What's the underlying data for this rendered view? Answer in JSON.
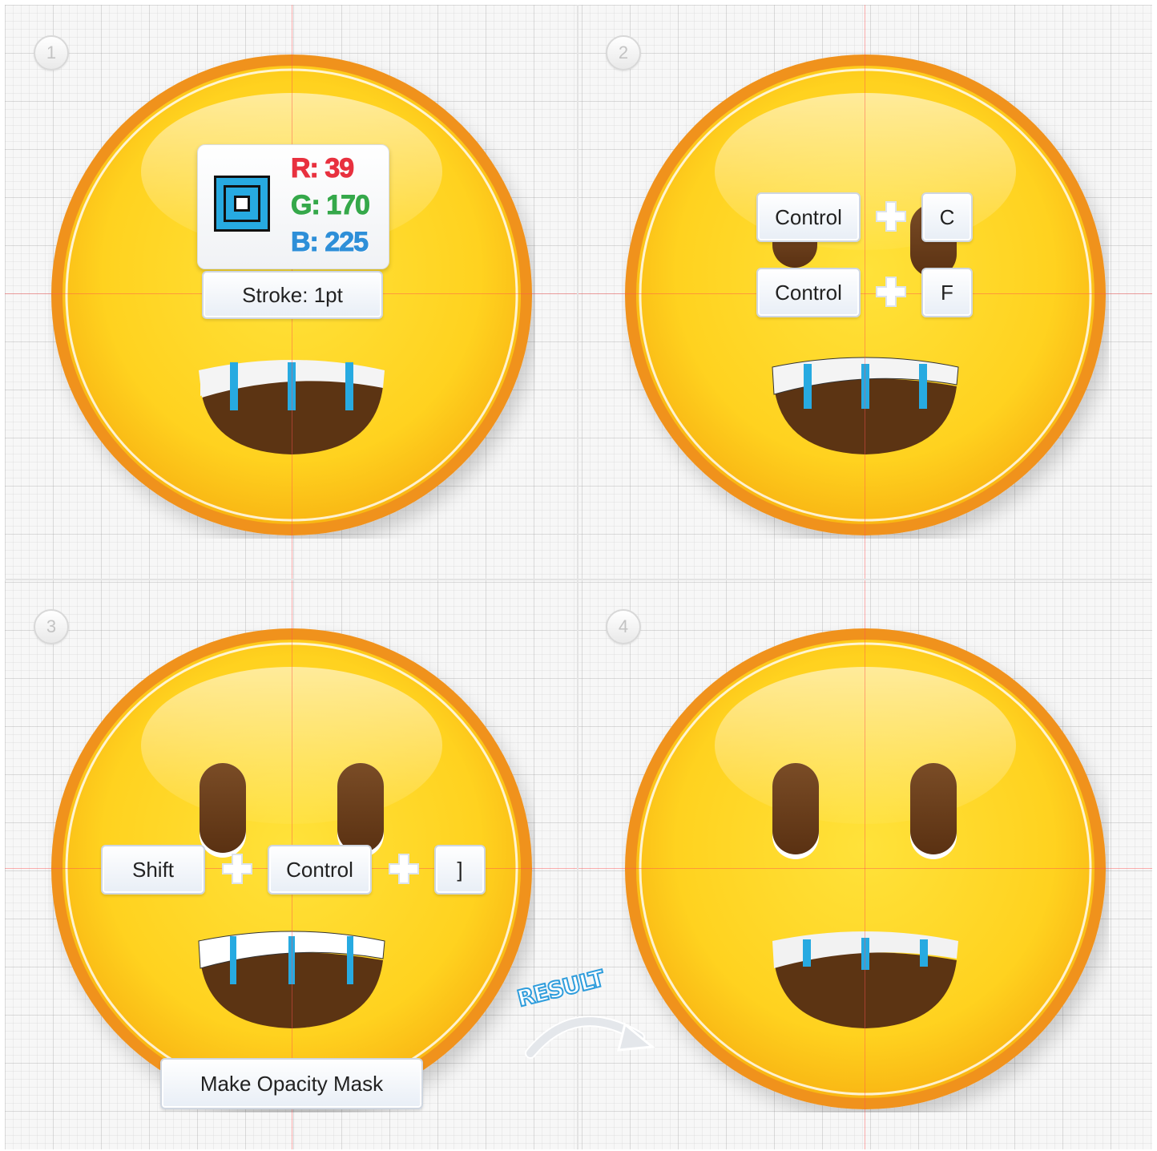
{
  "steps": [
    {
      "number": "1"
    },
    {
      "number": "2"
    },
    {
      "number": "3"
    },
    {
      "number": "4"
    }
  ],
  "step1": {
    "swatch_color": "#27AAE1",
    "r_label": "R: 39",
    "g_label": "G: 170",
    "b_label": "B: 225",
    "stroke_label": "Stroke: 1pt"
  },
  "step2": {
    "shortcut1": {
      "key1": "Control",
      "key2": "C"
    },
    "shortcut2": {
      "key1": "Control",
      "key2": "F"
    }
  },
  "step3": {
    "shortcut": {
      "key1": "Shift",
      "key2": "Control",
      "key3": "]"
    },
    "command_label": "Make Opacity Mask"
  },
  "result_label": "RESULT",
  "colors": {
    "face_fill": "#FFD21F",
    "face_rim": "#F0921E",
    "mouth": "#5C3413",
    "eyes": "#6B3F1B",
    "teeth": "#F2F2F2",
    "tooth_lines": "#27AAE1",
    "guide": "#FF5050",
    "r": "#E8313F",
    "g": "#35A84A",
    "b": "#2E8FD8"
  }
}
